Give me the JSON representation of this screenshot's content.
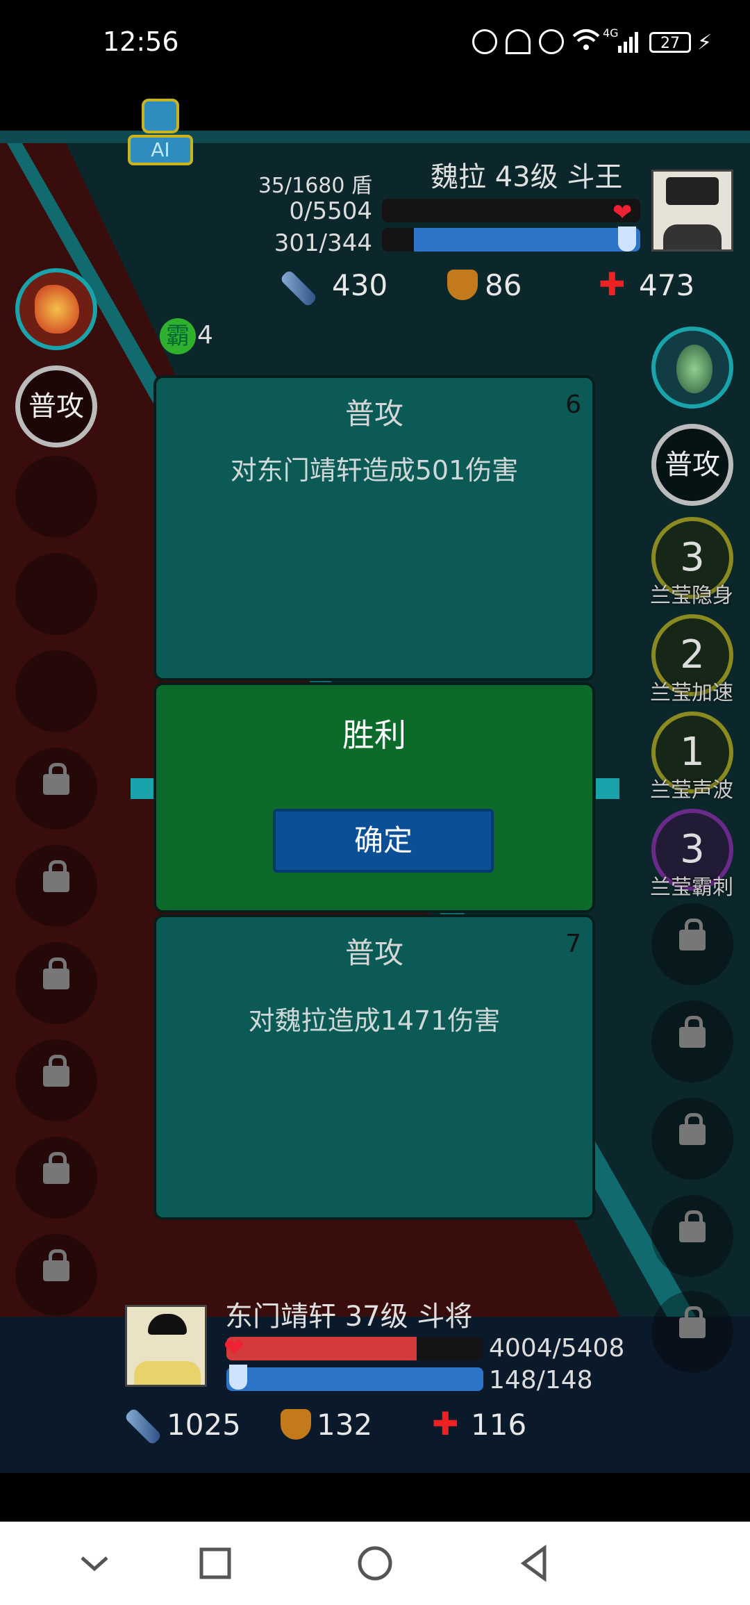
{
  "status_bar": {
    "time": "12:56",
    "battery": "27",
    "network": "4G"
  },
  "ai_badge": {
    "label": "AI"
  },
  "enemy": {
    "name_line": "魏拉 43级 斗王",
    "shield": "35/1680 盾",
    "hp": "0/5504",
    "mp": "301/344",
    "hp_fraction": 0.0,
    "mp_fraction": 0.875,
    "attack": "430",
    "defense": "86",
    "heal": "473"
  },
  "buff": {
    "label": "霸",
    "count": "4"
  },
  "left_skills": {
    "attack_label": "普攻"
  },
  "right_skills": {
    "attack_label": "普攻",
    "skills": [
      {
        "count": "3",
        "label": "兰莹隐身"
      },
      {
        "count": "2",
        "label": "兰莹加速"
      },
      {
        "count": "1",
        "label": "兰莹声波"
      },
      {
        "count": "3",
        "label": "兰莹霸刺"
      }
    ]
  },
  "log_top": {
    "title": "普攻",
    "turn": "6",
    "text": "对东门靖轩造成501伤害"
  },
  "victory": {
    "title": "胜利",
    "confirm_label": "确定"
  },
  "log_bottom": {
    "title": "普攻",
    "turn": "7",
    "text": "对魏拉造成1471伤害"
  },
  "player": {
    "name_line": "东门靖轩 37级 斗将",
    "hp": "4004/5408",
    "mp": "148/148",
    "hp_fraction": 0.74,
    "mp_fraction": 1.0,
    "attack": "1025",
    "defense": "132",
    "heal": "116"
  },
  "colors": {
    "accent_teal": "#19a3aa",
    "victory_green": "#0c6b2a",
    "button_blue": "#0b4f96",
    "hp_red": "#d33a3a",
    "mp_blue": "#2b74c7"
  }
}
